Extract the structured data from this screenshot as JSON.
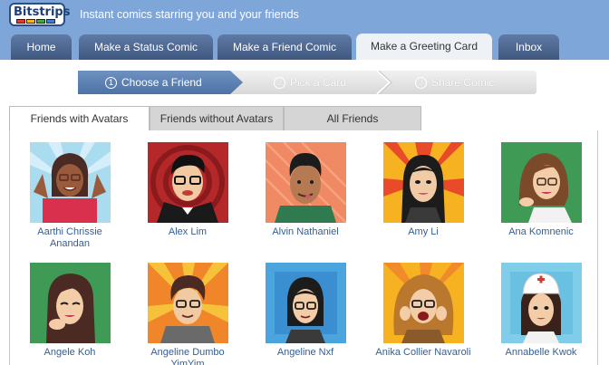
{
  "brand": {
    "logo_text": "Bitstrips",
    "tagline": "Instant comics starring you and your friends"
  },
  "nav_tabs": [
    {
      "label": "Home"
    },
    {
      "label": "Make a Status Comic"
    },
    {
      "label": "Make a Friend Comic"
    },
    {
      "label": "Make a Greeting Card"
    },
    {
      "label": "Inbox"
    }
  ],
  "active_tab": "Make a Greeting Card",
  "steps": [
    {
      "num": "1",
      "label": "Choose a Friend"
    },
    {
      "num": "2",
      "label": "Pick a Card"
    },
    {
      "num": "3",
      "label": "Share Comic"
    }
  ],
  "friend_tabs": [
    {
      "label": "Friends with Avatars"
    },
    {
      "label": "Friends without Avatars"
    },
    {
      "label": "All Friends"
    }
  ],
  "friends": [
    {
      "name": "Aarthi Chrissie Anandan",
      "avatar_bg": "#a9dcef"
    },
    {
      "name": "Alex Lim",
      "avatar_bg": "#b5282a"
    },
    {
      "name": "Alvin Nathaniel",
      "avatar_bg": "#f08a64"
    },
    {
      "name": "Amy Li",
      "avatar_bg": "#f6b220"
    },
    {
      "name": "Ana Komnenic",
      "avatar_bg": "#3e9a55"
    },
    {
      "name": "Angele Koh",
      "avatar_bg": "#3e9a55"
    },
    {
      "name": "Angeline Dumbo YimYim",
      "avatar_bg": "#f0852a"
    },
    {
      "name": "Angeline Nxf",
      "avatar_bg": "#4aa5df"
    },
    {
      "name": "Anika Collier Navaroli",
      "avatar_bg": "#f6b220"
    },
    {
      "name": "Annabelle Kwok",
      "avatar_bg": "#7fcde8"
    }
  ],
  "colors": {
    "header_bg": "#7fa6d8",
    "tab_bg": "#4a6591",
    "step_active": "#5b80b2",
    "link": "#355e93"
  }
}
